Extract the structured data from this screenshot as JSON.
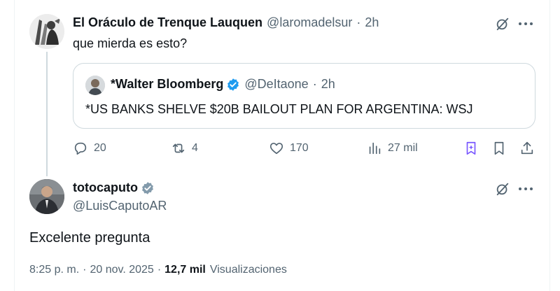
{
  "reply": {
    "author_name": "El Oráculo de Trenque Lauquen",
    "author_handle": "@laromadelsur",
    "separator": "·",
    "time": "2h",
    "text": "que mierda es esto?"
  },
  "quote": {
    "author_name": "*Walter Bloomberg",
    "author_handle": "@DeItaone",
    "separator": "·",
    "time": "2h",
    "text": "*US BANKS SHELVE $20B BAILOUT PLAN FOR ARGENTINA: WSJ"
  },
  "actions": {
    "replies": "20",
    "reposts": "4",
    "likes": "170",
    "views": "27 mil"
  },
  "main_post": {
    "author_name": "totocaputo",
    "author_handle": "@LuisCaputoAR",
    "text": "Excelente pregunta",
    "time": "8:25 p. m.",
    "separator": "·",
    "date": "20 nov. 2025",
    "views_count": "12,7 mil",
    "views_label": "Visualizaciones"
  },
  "colors": {
    "text": "#0f1419",
    "muted": "#536471",
    "border": "#cfd9de",
    "verified": "#1d9bf0",
    "verified_gov": "#829aab",
    "grok_accent": "#7856ff"
  },
  "icons": [
    "reply-icon",
    "repost-icon",
    "like-icon",
    "views-icon",
    "grok-icon",
    "bookmark-icon",
    "share-icon",
    "more-icon",
    "verified-icon"
  ]
}
